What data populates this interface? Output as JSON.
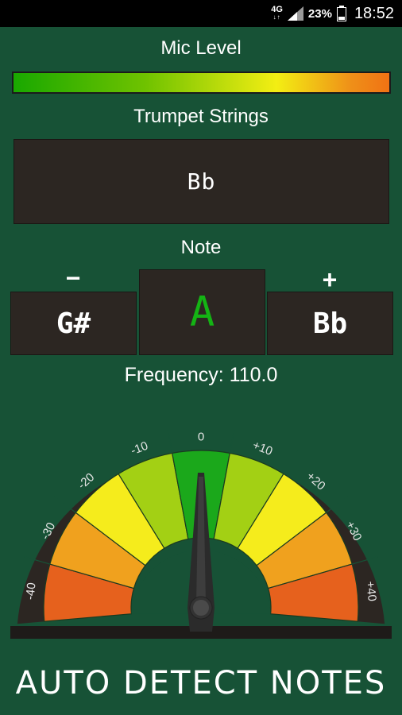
{
  "status_bar": {
    "network_type": "4G",
    "battery_percent": "23%",
    "time": "18:52"
  },
  "mic": {
    "label": "Mic Level"
  },
  "strings": {
    "label": "Trumpet Strings",
    "selected": "Bb"
  },
  "note": {
    "label": "Note",
    "minus_sign": "−",
    "plus_sign": "+",
    "previous": "G#",
    "current": "A",
    "next": "Bb"
  },
  "frequency": {
    "text": "Frequency: 110.0"
  },
  "gauge": {
    "ticks": [
      "-40",
      "-30",
      "-20",
      "-10",
      "0",
      "+10",
      "+20",
      "+30",
      "+40"
    ],
    "needle_cents": 0,
    "colors": [
      "#e6611d",
      "#f0a11e",
      "#f5ec1c",
      "#a3d014",
      "#1ba81b",
      "#a3d014",
      "#f5ec1c",
      "#f0a11e",
      "#e6611d"
    ]
  },
  "auto_detect": {
    "label": "AUTO DETECT NOTES"
  }
}
